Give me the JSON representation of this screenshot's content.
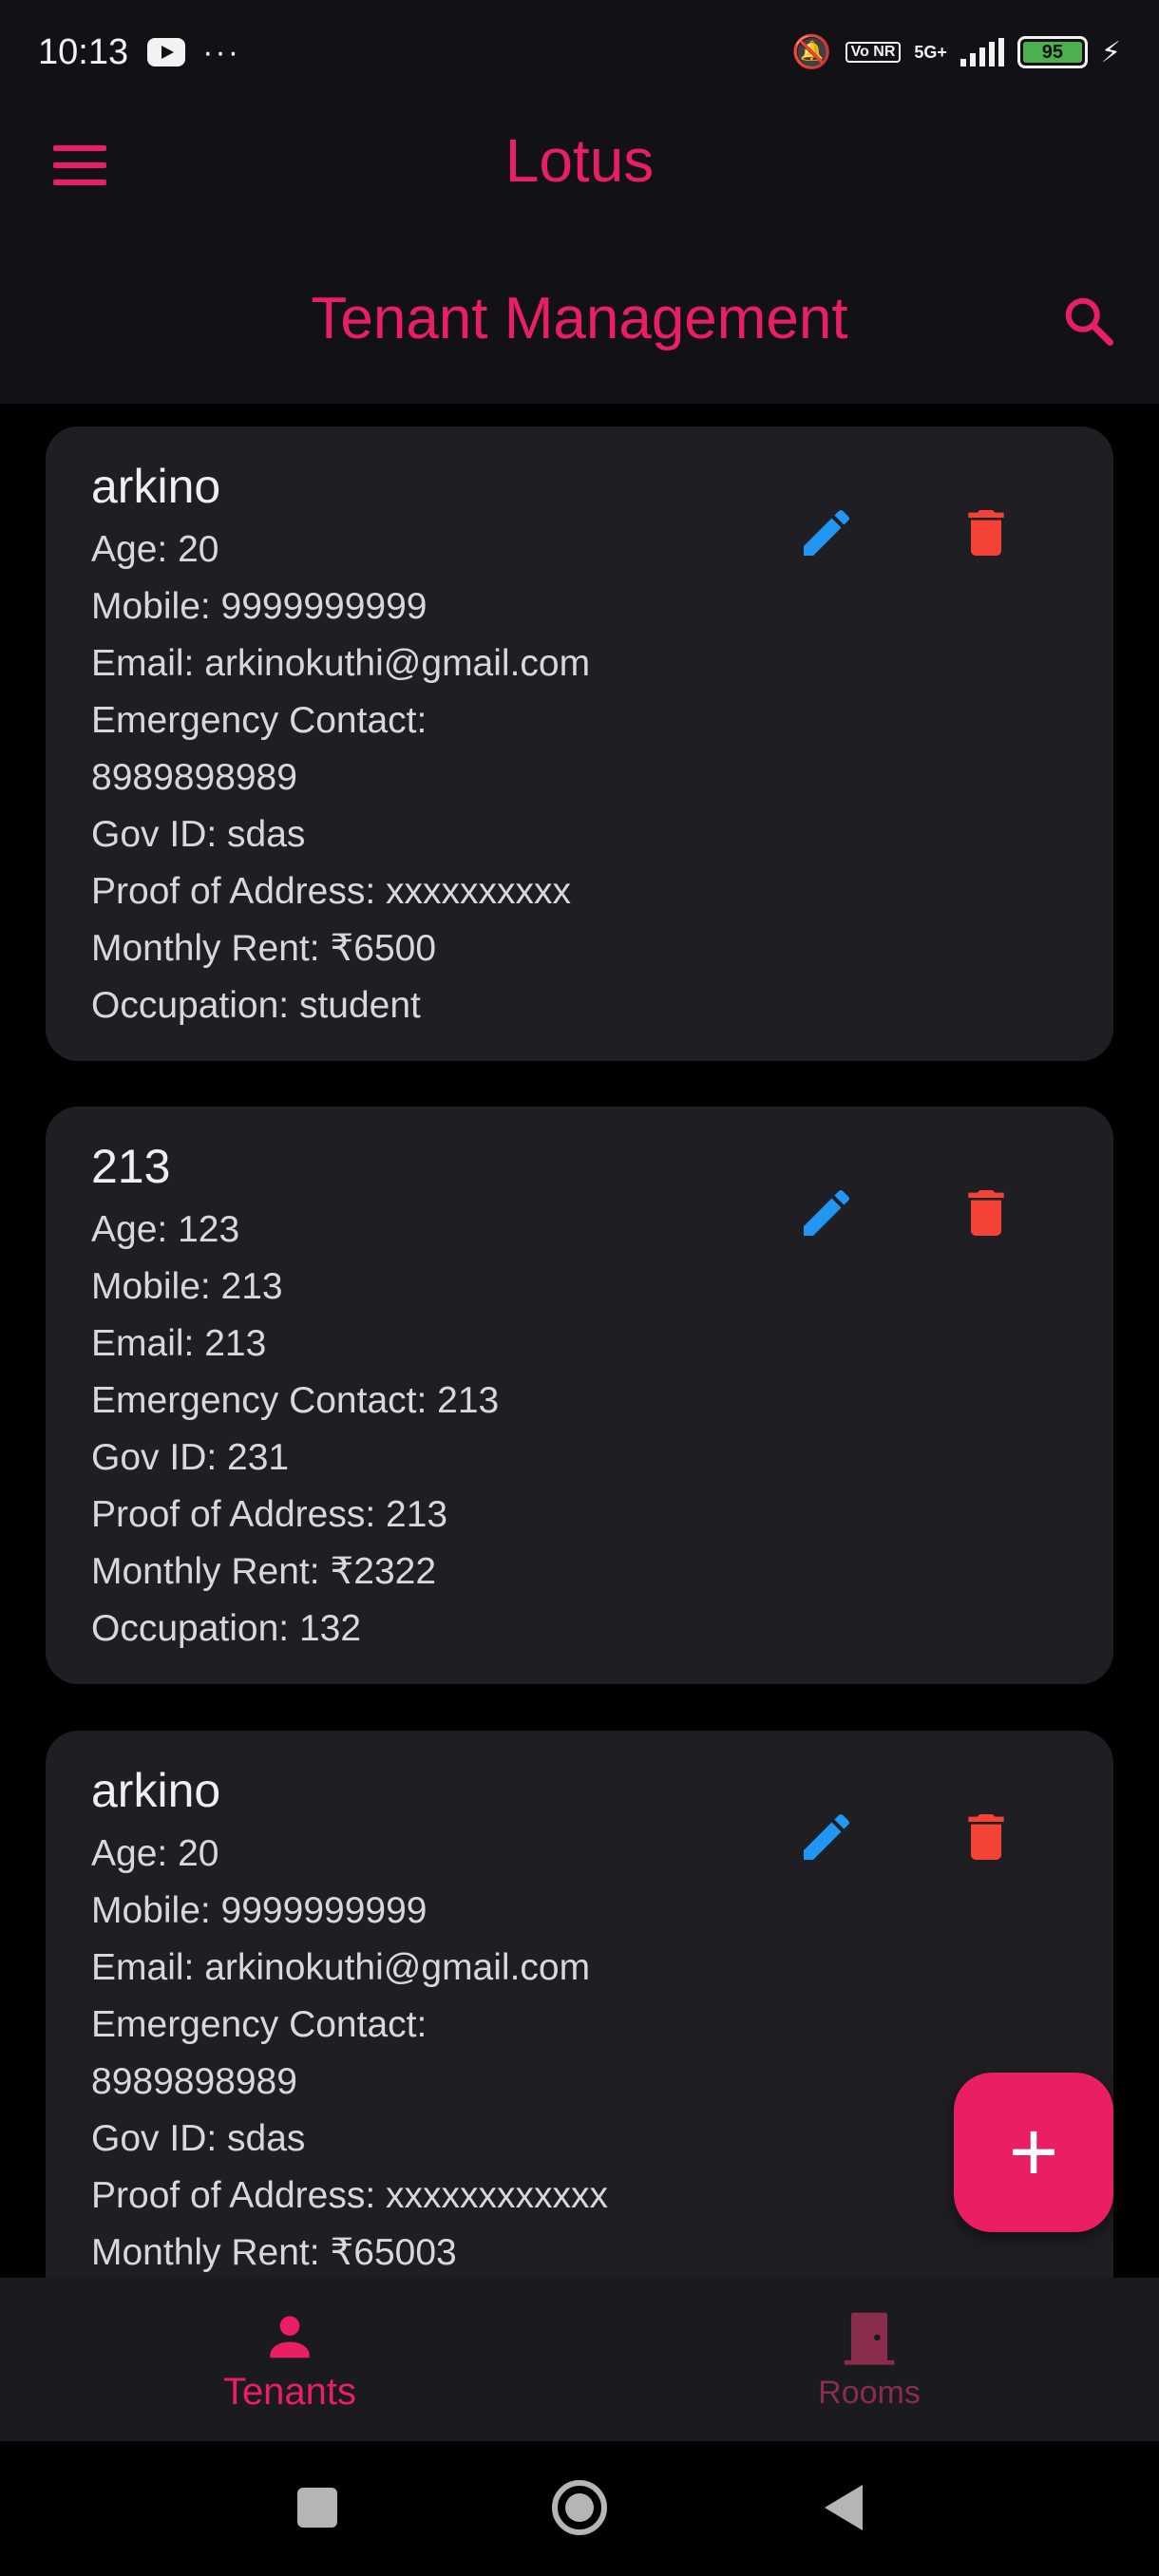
{
  "status_bar": {
    "time": "10:13",
    "dots": "···",
    "network": "5G+",
    "volte": "Vo NR",
    "battery": "95"
  },
  "app": {
    "title": "Lotus",
    "page_title": "Tenant Management",
    "accent": "#e91e63"
  },
  "tenants": [
    {
      "name": "arkino",
      "lines": [
        "Age: 20",
        "Mobile: 9999999999",
        "Email: arkinokuthi@gmail.com",
        "Emergency Contact:",
        "8989898989",
        "Gov ID: sdas",
        "Proof of Address: xxxxxxxxxx",
        "Monthly Rent: ₹6500",
        "Occupation: student"
      ]
    },
    {
      "name": "213",
      "lines": [
        "Age: 123",
        "Mobile: 213",
        "Email: 213",
        "Emergency Contact: 213",
        "Gov ID: 231",
        "Proof of Address: 213",
        "Monthly Rent: ₹2322",
        "Occupation: 132"
      ]
    },
    {
      "name": "arkino",
      "lines": [
        "Age: 20",
        "Mobile: 9999999999",
        "Email: arkinokuthi@gmail.com",
        "Emergency Contact:",
        "8989898989",
        "Gov ID: sdas",
        "Proof of Address: xxxxxxxxxxxx",
        "Monthly Rent: ₹65003"
      ]
    }
  ],
  "icons": {
    "edit": "pencil-icon",
    "delete": "trash-icon",
    "edit_color": "#2196f3",
    "delete_color": "#f44336"
  },
  "fab": {
    "label": "+"
  },
  "bottom_nav": {
    "items": [
      {
        "label": "Tenants",
        "icon": "person-icon",
        "active": true
      },
      {
        "label": "Rooms",
        "icon": "door-icon",
        "active": false
      }
    ]
  }
}
